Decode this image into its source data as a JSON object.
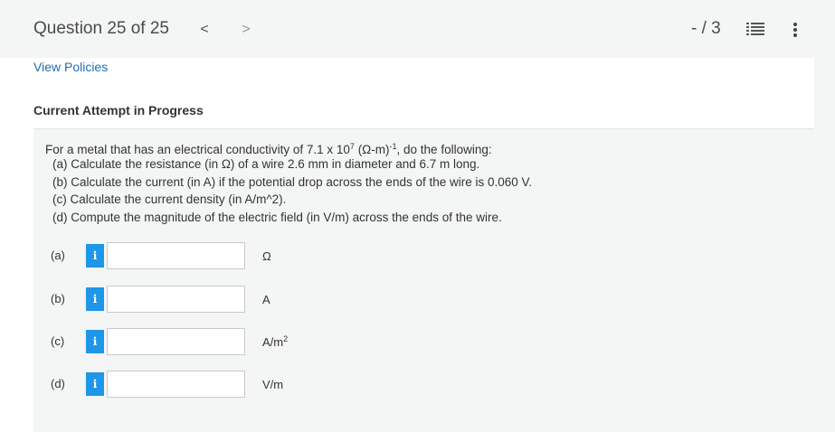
{
  "header": {
    "question_title": "Question 25 of 25",
    "prev_glyph": "<",
    "next_glyph": ">",
    "score": "- / 3"
  },
  "links": {
    "view_policies": "View Policies"
  },
  "attempt_status": "Current Attempt in Progress",
  "question": {
    "stem_prefix": "For a metal that has an electrical conductivity of 7.1 x 10",
    "stem_exp1": "7",
    "stem_mid": " (Ω-m)",
    "stem_exp2": "-1",
    "stem_suffix": ", do the following:",
    "parts": [
      "(a) Calculate the resistance (in Ω) of a wire 2.6 mm in diameter and 6.7 m long.",
      "(b) Calculate the current (in A) if the potential drop across the ends of the wire is 0.060 V.",
      "(c) Calculate the current density (in A/m^2).",
      "(d) Compute the magnitude of the electric field (in V/m) across the ends of the wire."
    ]
  },
  "answers": [
    {
      "label": "(a)",
      "info": "i",
      "value": "",
      "unit": "Ω",
      "unit_sup": ""
    },
    {
      "label": "(b)",
      "info": "i",
      "value": "",
      "unit": "A",
      "unit_sup": ""
    },
    {
      "label": "(c)",
      "info": "i",
      "value": "",
      "unit": "A/m",
      "unit_sup": "2"
    },
    {
      "label": "(d)",
      "info": "i",
      "value": "",
      "unit": "V/m",
      "unit_sup": ""
    }
  ],
  "colors": {
    "link": "#1f6fb5",
    "info_button": "#1f96e8",
    "background": "#f4f5f5"
  }
}
